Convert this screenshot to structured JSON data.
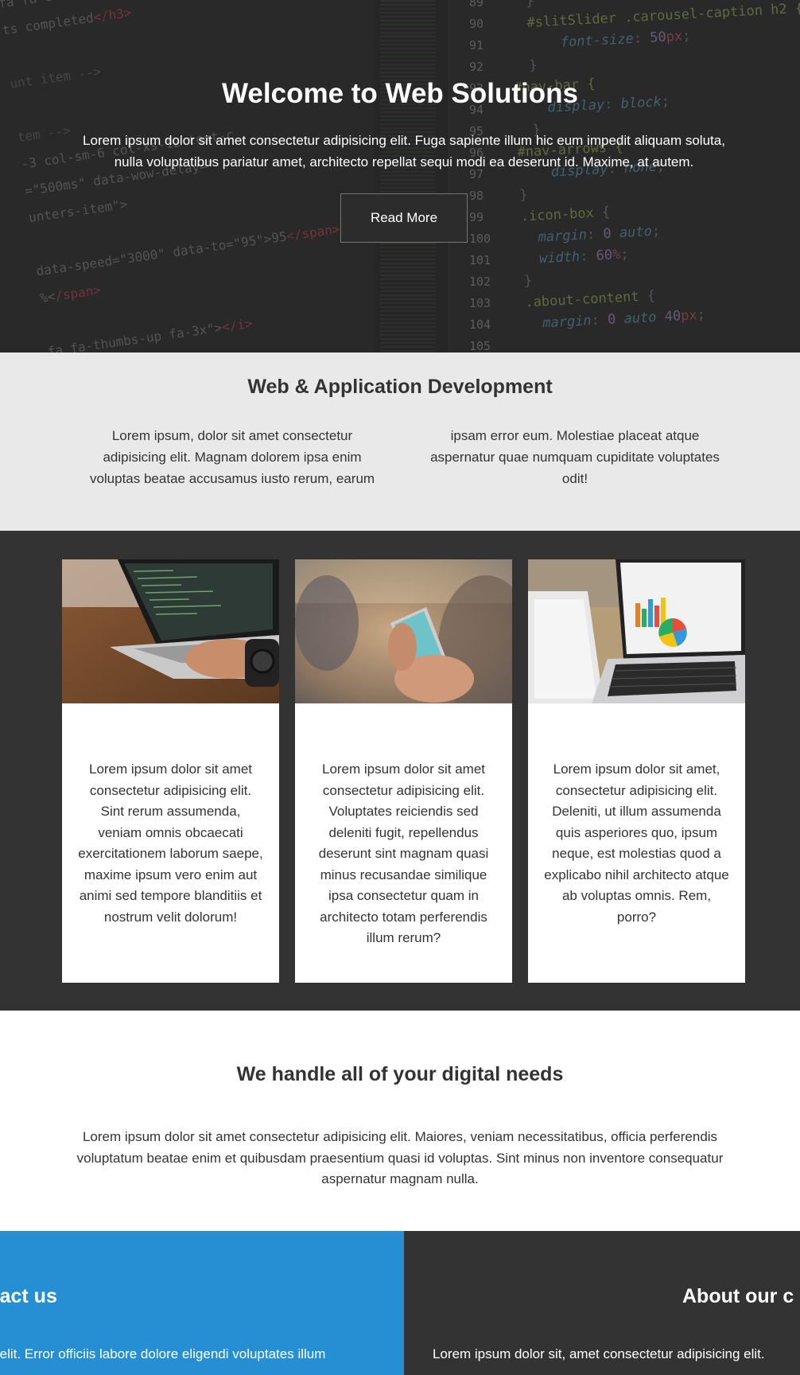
{
  "hero": {
    "title": "Welcome to Web Solutions",
    "text": "Lorem ipsum dolor sit amet consectetur adipisicing elit. Fuga sapiente illum hic eum impedit aliquam soluta, nulla voluptatibus pariatur amet, architecto repellat sequi modi ea deserunt id. Maxime, at autem.",
    "button_label": "Read More"
  },
  "intro": {
    "title": "Web & Application Development",
    "col1": "Lorem ipsum, dolor sit amet consectetur adipisicing elit. Magnam dolorem ipsa enim voluptas beatae accusamus iusto rerum, earum",
    "col2": "ipsam error eum. Molestiae placeat atque aspernatur quae numquam cupiditate voluptates odit!"
  },
  "cards": [
    {
      "image": "laptop-code-photo",
      "text": "Lorem ipsum dolor sit amet consectetur adipisicing elit. Sint rerum assumenda, veniam omnis obcaecati exercitationem laborum saepe, maxime ipsum vero enim aut animi sed tempore blanditiis et nostrum velit dolorum!"
    },
    {
      "image": "smartphone-photo",
      "text": "Lorem ipsum dolor sit amet consectetur adipisicing elit. Voluptates reiciendis sed deleniti fugit, repellendus deserunt sint magnam quasi minus recusandae similique ipsa consectetur quam in architecto totam perferendis illum rerum?"
    },
    {
      "image": "tablet-laptop-chart-photo",
      "text": "Lorem ipsum dolor sit amet, consectetur adipisicing elit. Deleniti, ut illum assumenda quis asperiores quo, ipsum neque, est molestias quod a explicabo nihil architecto atque ab voluptas omnis. Rem, porro?"
    }
  ],
  "digital": {
    "title": "We handle all of your digital needs",
    "text": "Lorem ipsum dolor sit amet consectetur adipisicing elit. Maiores, veniam necessitatibus, officia perferendis voluptatum beatae enim et quibusdam praesentium quasi id voluptas. Sint minus non inventore consequatur aspernatur magnam nulla."
  },
  "footer": {
    "contact_title": "ntact us",
    "contact_text": "ng elit. Error officiis labore dolore eligendi voluptates illum",
    "about_title": "About our c",
    "about_text": "Lorem ipsum dolor sit, amet consectetur adipisicing elit."
  },
  "colors": {
    "hero_bg": "#2a2a2a",
    "intro_bg": "#e9e9e9",
    "cards_bg": "#333333",
    "contact_bg": "#268fd4",
    "about_bg": "#333333"
  }
}
